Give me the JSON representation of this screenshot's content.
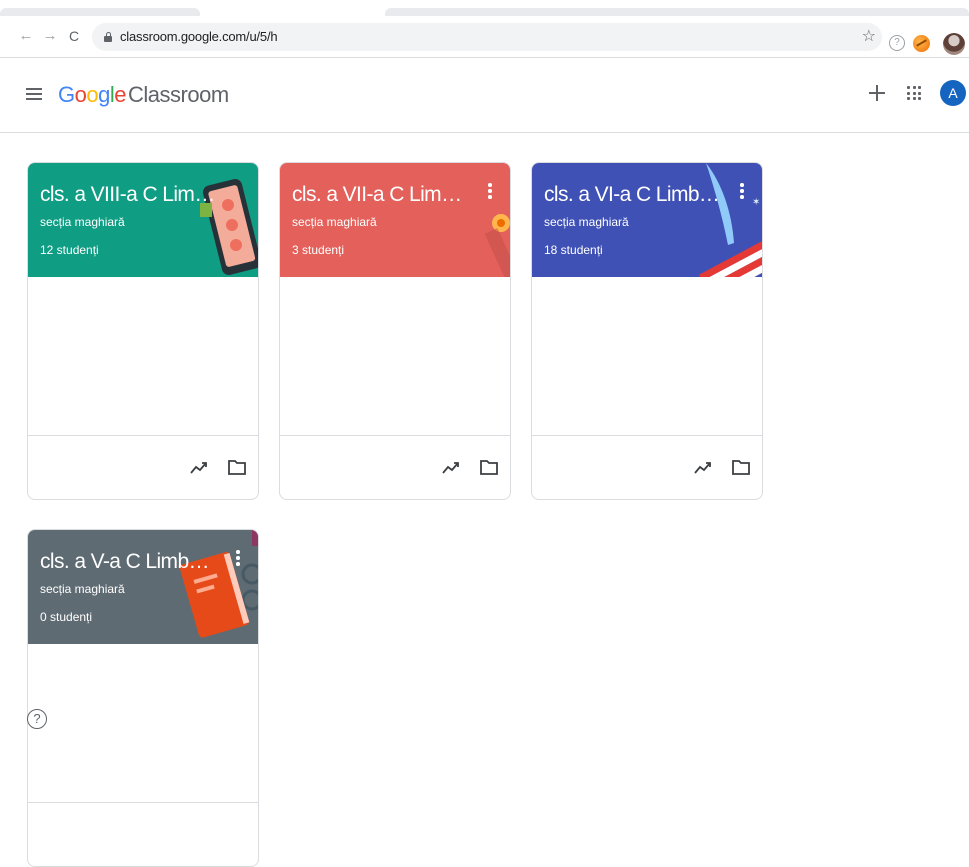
{
  "browser": {
    "back_icon": "←",
    "forward_icon": "→",
    "reload_icon": "C",
    "url": "classroom.google.com/u/5/h",
    "star_icon": "☆",
    "help_ext_icon": "?"
  },
  "header": {
    "logo_letters": [
      "G",
      "o",
      "o",
      "g",
      "l",
      "e"
    ],
    "product": "Classroom",
    "avatar_letter": "A"
  },
  "classes": [
    {
      "title": "cls. a VIII-a C Limba și literatura română",
      "section": "secția maghiară",
      "students": "12 studenți",
      "color": "#0f9d83"
    },
    {
      "title": "cls. a VII-a C Limba și literatura română",
      "section": "secția maghiară",
      "students": "3 studenți",
      "color": "#e4605b"
    },
    {
      "title": "cls. a VI-a C Limba și literatura română",
      "section": "secția maghiară",
      "students": "18 studenți",
      "color": "#3f51b5"
    },
    {
      "title": "cls. a V-a C Limba și literatura română",
      "section": "secția maghiară",
      "students": "0 studenți",
      "color": "#5f6b73"
    }
  ],
  "help_label": "?"
}
